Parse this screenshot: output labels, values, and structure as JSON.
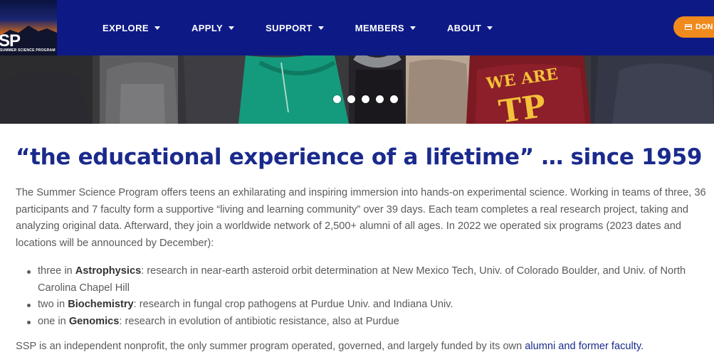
{
  "header": {
    "logo": {
      "text": "SP",
      "tagline": "SUMMER SCIENCE PROGRAM"
    },
    "nav": [
      {
        "label": "EXPLORE"
      },
      {
        "label": "APPLY"
      },
      {
        "label": "SUPPORT"
      },
      {
        "label": "MEMBERS"
      },
      {
        "label": "ABOUT"
      }
    ],
    "donate_label": "DON",
    "colors": {
      "nav_bg": "#0d1a86",
      "donate_bg": "#f08a1c"
    }
  },
  "hero": {
    "shirt_text_1": "WE ARE",
    "shirt_text_2": "TP",
    "slide_count": 5
  },
  "content": {
    "headline": "“the educational experience of a lifetime” … since 1959",
    "intro": "The Summer Science Program offers teens an exhilarating and inspiring immersion into hands-on experimental science. Working in teams of three, 36 participants and 7 faculty form a supportive “living and learning community” over 39 days. Each team completes a real research project, taking and analyzing original data. Afterward, they join a worldwide network of 2,500+ alumni of all ages. In 2022 we operated six programs (2023 dates and locations will be announced by December):",
    "programs": [
      {
        "prefix": "three in ",
        "subject": "Astrophysics",
        "detail": ": research in near-earth asteroid orbit determination at New Mexico Tech, Univ. of Colorado Boulder, and Univ. of North Carolina Chapel Hill"
      },
      {
        "prefix": "two in ",
        "subject": "Biochemistry",
        "detail": ": research in fungal crop pathogens at Purdue Univ. and Indiana Univ."
      },
      {
        "prefix": "one in ",
        "subject": "Genomics",
        "detail": ": research in evolution of antibiotic resistance, also at Purdue"
      }
    ],
    "footer_text": "SSP is an independent nonprofit, the only summer program operated, governed, and largely funded by its own ",
    "footer_link": "alumni and former faculty."
  }
}
